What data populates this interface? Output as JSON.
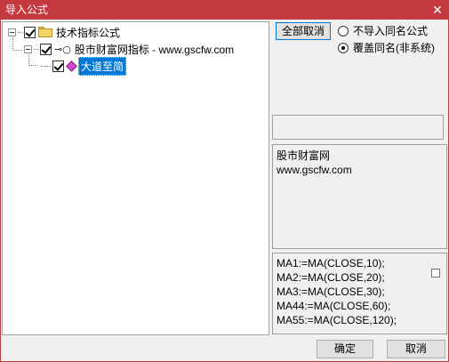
{
  "window": {
    "title": "导入公式",
    "close_glyph": "✕"
  },
  "tree": {
    "root": {
      "label": "技术指标公式",
      "checked": true,
      "icon": "folder-icon"
    },
    "child": {
      "label": "股市财富网指标 - www.gscfw.com",
      "checked": true,
      "icon": "key-icon",
      "icon_glyph": "⊸○"
    },
    "leaf": {
      "label": "大道至简",
      "checked": true,
      "selected": true,
      "icon": "diamond-icon"
    }
  },
  "controls": {
    "cancel_all_label": "全部取消",
    "options": [
      {
        "label": "不导入同名公式",
        "selected": false
      },
      {
        "label": "覆盖同名(非系统)",
        "selected": true
      }
    ]
  },
  "info": {
    "lines": [
      "股市财富网",
      "www.gscfw.com"
    ]
  },
  "code": {
    "lines": [
      "MA1:=MA(CLOSE,10);",
      "MA2:=MA(CLOSE,20);",
      "MA3:=MA(CLOSE,30);",
      "MA44:=MA(CLOSE,60);",
      "MA55:=MA(CLOSE,120);"
    ]
  },
  "footer": {
    "ok_label": "确定",
    "cancel_label": "取消"
  }
}
